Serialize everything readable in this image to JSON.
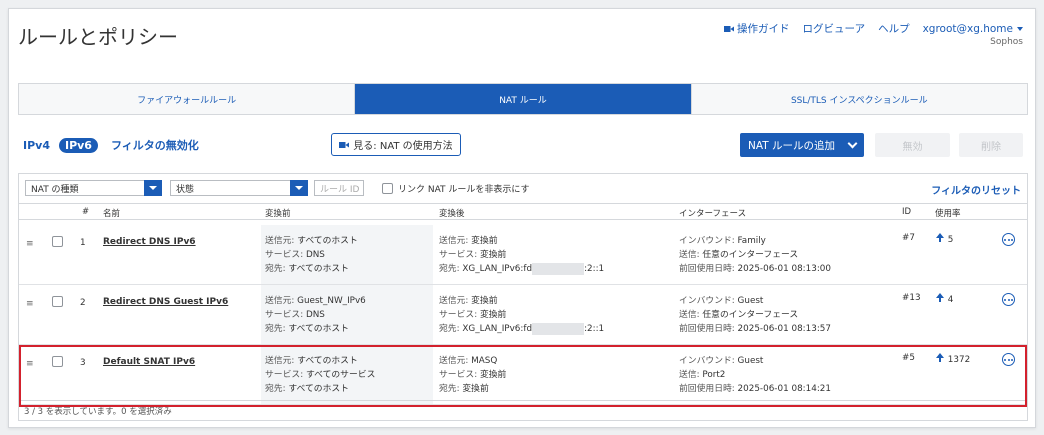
{
  "page": {
    "title": "ルールとポリシー"
  },
  "topnav": {
    "guide": "操作ガイド",
    "log": "ログビューア",
    "help": "ヘルプ",
    "user": "xgroot@xg.home",
    "org": "Sophos"
  },
  "tabs": [
    {
      "label": "ファイアウォールルール",
      "active": false
    },
    {
      "label": "NAT ルール",
      "active": true
    },
    {
      "label": "SSL/TLS インスペクションルール",
      "active": false
    }
  ],
  "toolbar": {
    "ipv4": "IPv4",
    "ipv6": "IPv6",
    "disable_filter": "フィルタの無効化",
    "howto": "見る: NAT の使用方法",
    "add": "NAT ルールの追加",
    "disable": "無効",
    "delete": "削除"
  },
  "filters": {
    "nat_type": "NAT の種類",
    "status": "状態",
    "rule_id_placeholder": "ルール ID",
    "hide_linked": "リンク NAT ルールを非表示にす",
    "reset": "フィルタのリセット"
  },
  "columns": {
    "num": "#",
    "name": "名前",
    "before": "変換前",
    "after": "変換後",
    "iface": "インターフェース",
    "id": "ID",
    "usage": "使用率"
  },
  "rows": [
    {
      "num": "1",
      "name": "Redirect DNS IPv6",
      "before": [
        [
          "送信元:",
          "すべてのホスト"
        ],
        [
          "サービス:",
          "DNS"
        ],
        [
          "宛先:",
          "すべてのホスト"
        ]
      ],
      "after": [
        [
          "送信元:",
          "変換前"
        ],
        [
          "サービス:",
          "変換前"
        ],
        [
          "宛先:",
          "XG_LAN_IPv6:fd"
        ]
      ],
      "after_suffix": ":2::1",
      "iface": [
        [
          "インバウンド:",
          "Family"
        ],
        [
          "送信:",
          "任意のインターフェース"
        ],
        [
          "前回使用日時:",
          "2025-06-01 08:13:00"
        ]
      ],
      "id": "#7",
      "usage": "5"
    },
    {
      "num": "2",
      "name": "Redirect DNS Guest IPv6",
      "before": [
        [
          "送信元:",
          "Guest_NW_IPv6"
        ],
        [
          "サービス:",
          "DNS"
        ],
        [
          "宛先:",
          "すべてのホスト"
        ]
      ],
      "after": [
        [
          "送信元:",
          "変換前"
        ],
        [
          "サービス:",
          "変換前"
        ],
        [
          "宛先:",
          "XG_LAN_IPv6:fd"
        ]
      ],
      "after_suffix": ":2::1",
      "iface": [
        [
          "インバウンド:",
          "Guest"
        ],
        [
          "送信:",
          "任意のインターフェース"
        ],
        [
          "前回使用日時:",
          "2025-06-01 08:13:57"
        ]
      ],
      "id": "#13",
      "usage": "4"
    },
    {
      "num": "3",
      "name": "Default SNAT IPv6",
      "before": [
        [
          "送信元:",
          "すべてのホスト"
        ],
        [
          "サービス:",
          "すべてのサービス"
        ],
        [
          "宛先:",
          "すべてのホスト"
        ]
      ],
      "after": [
        [
          "送信元:",
          "MASQ"
        ],
        [
          "サービス:",
          "変換前"
        ],
        [
          "宛先:",
          "変換前"
        ]
      ],
      "after_suffix": "",
      "iface": [
        [
          "インバウンド:",
          "Guest"
        ],
        [
          "送信:",
          "Port2"
        ],
        [
          "前回使用日時:",
          "2025-06-01 08:14:21"
        ]
      ],
      "id": "#5",
      "usage": "1372"
    }
  ],
  "footer": "3 / 3 を表示しています。0 を選択済み",
  "accent": "#1b5cb6",
  "highlight": "#d3212d"
}
